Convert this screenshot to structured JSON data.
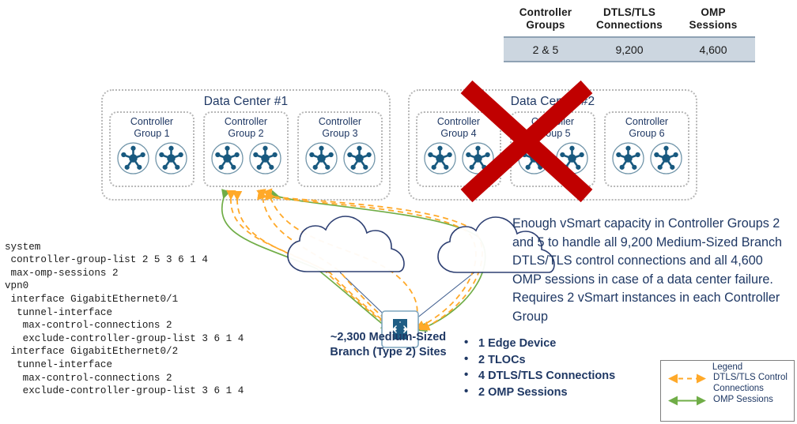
{
  "summary_table": {
    "headers": [
      "Controller Groups",
      "DTLS/TLS Connections",
      "OMP Sessions"
    ],
    "header_lines": [
      [
        "Controller",
        "Groups"
      ],
      [
        "DTLS/TLS",
        "Connections"
      ],
      [
        "OMP",
        "Sessions"
      ]
    ],
    "row": [
      "2 & 5",
      "9,200",
      "4,600"
    ],
    "header_color": "#1A1A1A",
    "row_bg": "#CCD6E0",
    "rule_color": "#8FA2B4"
  },
  "data_centers": [
    {
      "title": "Data Center #1",
      "groups": [
        {
          "line1": "Controller",
          "line2": "Group 1",
          "icon": "vsmart-controller-icon",
          "count": 2
        },
        {
          "line1": "Controller",
          "line2": "Group 2",
          "icon": "vsmart-controller-icon",
          "count": 2
        },
        {
          "line1": "Controller",
          "line2": "Group 3",
          "icon": "vsmart-controller-icon",
          "count": 2
        }
      ]
    },
    {
      "title": "Data Center #2",
      "failed": true,
      "groups": [
        {
          "line1": "Controller",
          "line2": "Group 4",
          "icon": "vsmart-controller-icon",
          "count": 2
        },
        {
          "line1": "Controller",
          "line2": "Group 5",
          "icon": "vsmart-controller-icon",
          "count": 2
        },
        {
          "line1": "Controller",
          "line2": "Group 6",
          "icon": "vsmart-controller-icon",
          "count": 2
        }
      ]
    }
  ],
  "failure_marker": {
    "name": "red-x-failure-icon",
    "color": "#C00000"
  },
  "config": {
    "text": "system\n controller-group-list 2 5 3 6 1 4\n max-omp-sessions 2\nvpn0\n interface GigabitEthernet0/1\n  tunnel-interface\n   max-control-connections 2\n   exclude-controller-group-list 3 6 1 4\n interface GigabitEthernet0/2\n  tunnel-interface\n   max-control-connections 2\n   exclude-controller-group-list 3 6 1 4"
  },
  "explanation": {
    "text": "Enough vSmart capacity in Controller Groups 2 and 5 to handle all 9,200 Medium-Sized Branch DTLS/TLS control connections and all 4,600 OMP sessions in case of a data center failure.  Requires 2 vSmart instances in each Controller Group"
  },
  "branch": {
    "label_line1": "~2,300 Medium-Sized",
    "label_line2": "Branch (Type 2) Sites",
    "icon": "edge-device-router-icon"
  },
  "branch_stats": [
    "1 Edge Device",
    "2 TLOCs",
    "4 DTLS/TLS Connections",
    "2 OMP Sessions"
  ],
  "legend": {
    "title": "Legend",
    "items": [
      {
        "label_line1": "DTLS/TLS  Control",
        "label_line2": "Connections",
        "color": "#FFA929",
        "style": "dashed",
        "icon": "dashed-double-arrow-icon"
      },
      {
        "label_line1": "OMP Sessions",
        "label_line2": "",
        "color": "#70AD47",
        "style": "solid",
        "icon": "solid-double-arrow-icon"
      }
    ]
  },
  "network": {
    "cloud_count": 2,
    "cloud_outline": "#22356B",
    "control_color": "#FFA929",
    "omp_color": "#70AD47",
    "controller_color": "#18597F"
  }
}
